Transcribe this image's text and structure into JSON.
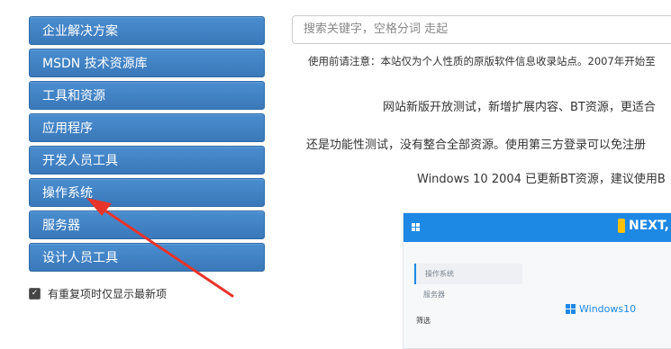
{
  "sidebar": {
    "items": [
      {
        "label": "企业解决方案"
      },
      {
        "label": "MSDN 技术资源库"
      },
      {
        "label": "工具和资源"
      },
      {
        "label": "应用程序"
      },
      {
        "label": "开发人员工具"
      },
      {
        "label": "操作系统"
      },
      {
        "label": "服务器"
      },
      {
        "label": "设计人员工具"
      }
    ],
    "checkbox_label": "有重复项时仅显示最新项",
    "checkbox_checked": true
  },
  "search": {
    "placeholder": "搜索关键字，空格分词 走起"
  },
  "notice": {
    "line1": "使用前请注意：本站仅为个人性质的原版软件信息收录站点。2007年开始至",
    "line2": "网站新版开放测试，新增扩展内容、BT资源，更适合",
    "line3": "还是功能性测试，没有整合全部资源。使用第三方登录可以免注册",
    "line4": "Windows 10 2004 已更新BT资源，建议使用B"
  },
  "preview": {
    "brand": "NEXT,",
    "menu": [
      "操作系统",
      "服务器"
    ],
    "filter_label": "筛选",
    "os_label": "Windows10"
  },
  "colors": {
    "menu_button": "#3a78b9",
    "preview_bar": "#1e88e5",
    "arrow": "#e8342a"
  }
}
